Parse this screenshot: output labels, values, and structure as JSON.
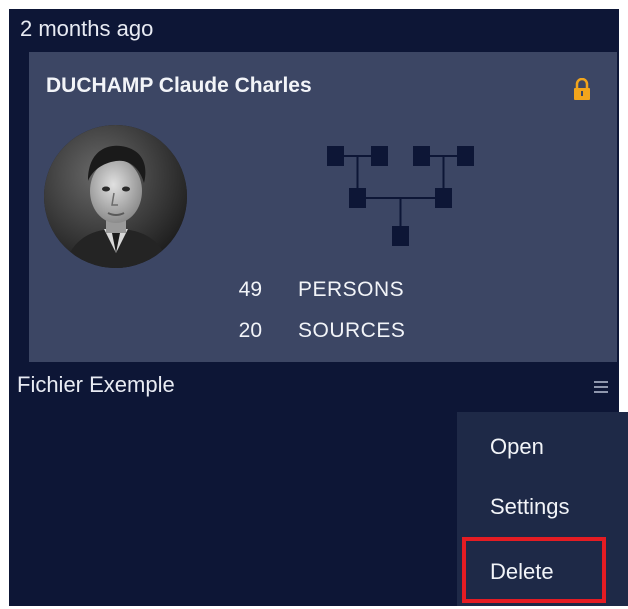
{
  "card": {
    "timestamp": "2 months ago",
    "owner_name": "DUCHAMP Claude Charles",
    "lock_icon": "lock-icon",
    "stats": [
      {
        "value": "49",
        "label": "PERSONS"
      },
      {
        "value": "20",
        "label": "SOURCES"
      }
    ],
    "file_name": "Fichier Exemple",
    "menu_icon": "hamburger-menu-icon"
  },
  "menu": {
    "items": [
      {
        "label": "Open"
      },
      {
        "label": "Settings"
      },
      {
        "label": "Delete"
      }
    ]
  },
  "colors": {
    "background": "#0d1636",
    "card": "#3c4664",
    "dropdown": "#1e2947",
    "lock": "#f2a51c",
    "highlight": "#e51c23"
  }
}
